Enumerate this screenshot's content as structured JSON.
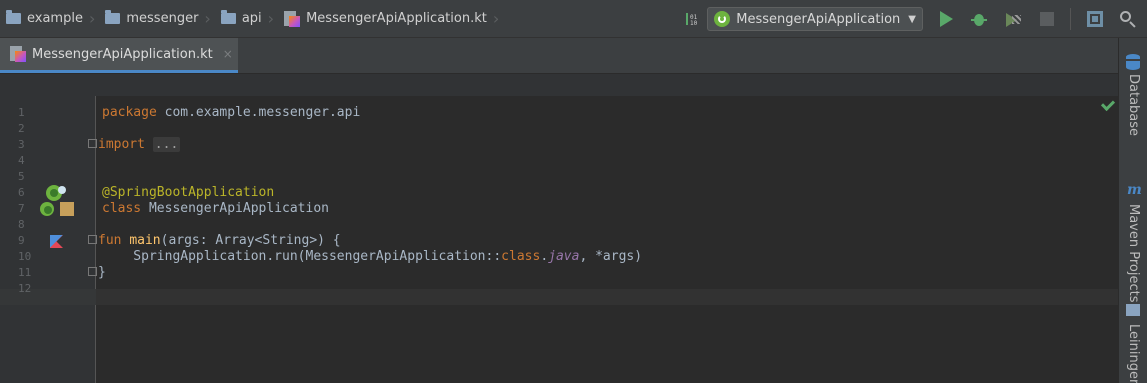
{
  "breadcrumb": {
    "items": [
      {
        "label": "example",
        "icon": "folder-icon"
      },
      {
        "label": "messenger",
        "icon": "folder-icon"
      },
      {
        "label": "api",
        "icon": "folder-icon"
      },
      {
        "label": "MessengerApiApplication.kt",
        "icon": "kotlin-file-icon"
      }
    ]
  },
  "toolbar": {
    "run_config_label": "MessengerApiApplication",
    "icons": [
      "build-numbers-icon",
      "spring-boot-icon",
      "chevron-down-icon",
      "run-icon",
      "debug-icon",
      "coverage-icon",
      "stop-icon",
      "project-structure-icon",
      "search-icon"
    ]
  },
  "tabs": [
    {
      "label": "MessengerApiApplication.kt",
      "active": true,
      "close": "×"
    }
  ],
  "editor": {
    "line_numbers": [
      "1",
      "2",
      "3",
      "4",
      "5",
      "6",
      "7",
      "8",
      "9",
      "10",
      "11",
      "12"
    ],
    "code": {
      "l1_kw": "package",
      "l1_rest": " com.example.messenger.api",
      "l3_kw": "import",
      "l3_collapsed": "...",
      "l6_ann": "@SpringBootApplication",
      "l7_kw": "class",
      "l7_rest": " MessengerApiApplication",
      "l9_kw": "fun",
      "l9_fn": "main",
      "l9_rest": "(args: Array<String>) {",
      "l10_a": "    SpringApplication.run(MessengerApiApplication::",
      "l10_kw": "class",
      "l10_dot": ".",
      "l10_it": "java",
      "l10_b": ", *args)",
      "l11": "}"
    },
    "status": "no-problems"
  },
  "side_tools": [
    {
      "label": "Database",
      "icon": "database-icon"
    },
    {
      "label": "Maven Projects",
      "icon": "maven-icon"
    },
    {
      "label": "Leiningen",
      "icon": "leiningen-icon"
    }
  ],
  "colors": {
    "keyword": "#cc7832",
    "function": "#ffc66d",
    "annotation": "#bbb529",
    "italic_member": "#9876aa",
    "default_text": "#a9b7c6",
    "tab_underline": "#4a88c7"
  }
}
